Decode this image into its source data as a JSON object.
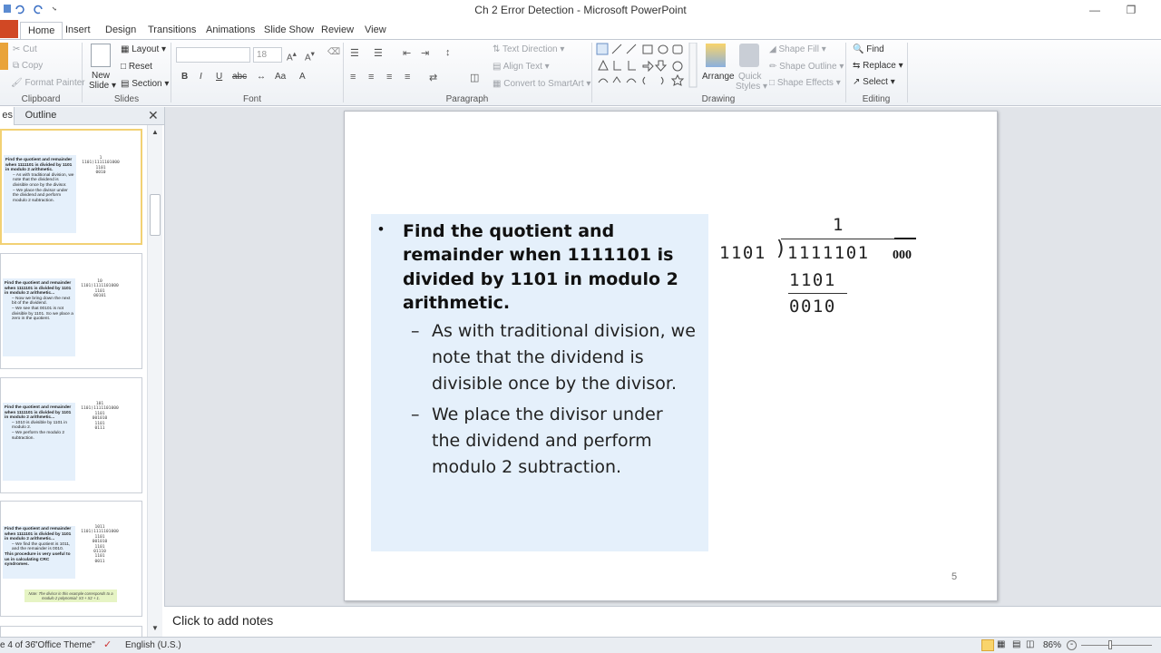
{
  "window": {
    "title": "Ch 2 Error Detection - Microsoft PowerPoint"
  },
  "tabs": [
    "Home",
    "Insert",
    "Design",
    "Transitions",
    "Animations",
    "Slide Show",
    "Review",
    "View"
  ],
  "ribbon": {
    "clipboard": {
      "cut": "Cut",
      "copy": "Copy",
      "format_painter": "Format Painter",
      "label": "Clipboard"
    },
    "slides": {
      "new_slide": "New",
      "new_slide2": "Slide",
      "layout": "Layout",
      "reset": "Reset",
      "section": "Section",
      "label": "Slides"
    },
    "font": {
      "size": "18",
      "label": "Font"
    },
    "paragraph": {
      "text_direction": "Text Direction",
      "align_text": "Align Text",
      "smartart": "Convert to SmartArt",
      "label": "Paragraph"
    },
    "drawing": {
      "arrange": "Arrange",
      "quick_styles": "Quick",
      "quick_styles2": "Styles",
      "shape_fill": "Shape Fill",
      "shape_outline": "Shape Outline",
      "shape_effects": "Shape Effects",
      "label": "Drawing"
    },
    "editing": {
      "find": "Find",
      "replace": "Replace",
      "select": "Select",
      "label": "Editing"
    }
  },
  "pane": {
    "tab_slides": "es",
    "tab_outline": "Outline"
  },
  "thumbnails": [
    {
      "title": "Find the quotient and remainder when 1111101 is divided by 1101 in modulo 2 arithmetic.",
      "bullets": [
        "As with traditional division, we note that the dividend is divisible once by the divisor.",
        "We place the divisor under the dividend and perform modulo 2 subtraction."
      ],
      "math": [
        "1",
        "1101)1111101000",
        "1101",
        "0010"
      ]
    },
    {
      "title": "Find the quotient and remainder when 1111101 is divided by 1101 in modulo 2 arithmetic...",
      "bullets": [
        "Now we bring down the next bit of the dividend.",
        "We see that 00101 is not divisible by 1101. So we place a zero in the quotient."
      ],
      "math": [
        "10",
        "1101)1111101000",
        "1101",
        "00101"
      ]
    },
    {
      "title": "Find the quotient and remainder when 1111101 is divided by 1101 in modulo 2 arithmetic...",
      "bullets": [
        "1010 is divisible by 1101 in modulo 2.",
        "We perform the modulo 2 subtraction."
      ],
      "math": [
        "101",
        "1101)1111101000",
        "1101",
        "001010",
        "1101",
        "0111"
      ]
    },
    {
      "title": "Find the quotient and remainder when 1111101 is divided by 1101 in modulo 2 arithmetic...",
      "bullets": [
        "We find the quotient is 1011, and the remainder is 0010."
      ],
      "extra": "This procedure is very useful to us in calculating CRC syndromes.",
      "note": "Note: The divisor in this example corresponds to a modulo 2 polynomial: X3 + X2 + 1.",
      "math": [
        "1011",
        "1101)1111101000",
        "1101",
        "001010",
        "1101",
        "01110",
        "1101",
        "0011"
      ]
    }
  ],
  "slide": {
    "main_bullet": "Find the quotient and remainder when 1111101 is divided by 1101 in modulo 2 arithmetic.",
    "sub_bullets": [
      "As with traditional division, we note that the dividend is divisible once by the divisor.",
      "We place the divisor under the dividend and perform modulo 2 subtraction."
    ],
    "division": {
      "quotient": "1",
      "divisor": "1101",
      "dividend": "1111101",
      "padding": "000",
      "subtrahend": "1101",
      "remainder": "0010"
    },
    "page_number": "5"
  },
  "notes": {
    "placeholder": "Click to add notes"
  },
  "status": {
    "slide_info": "4 of 36",
    "theme": "\"Office Theme\"",
    "language": "English (U.S.)",
    "zoom": "86%"
  }
}
